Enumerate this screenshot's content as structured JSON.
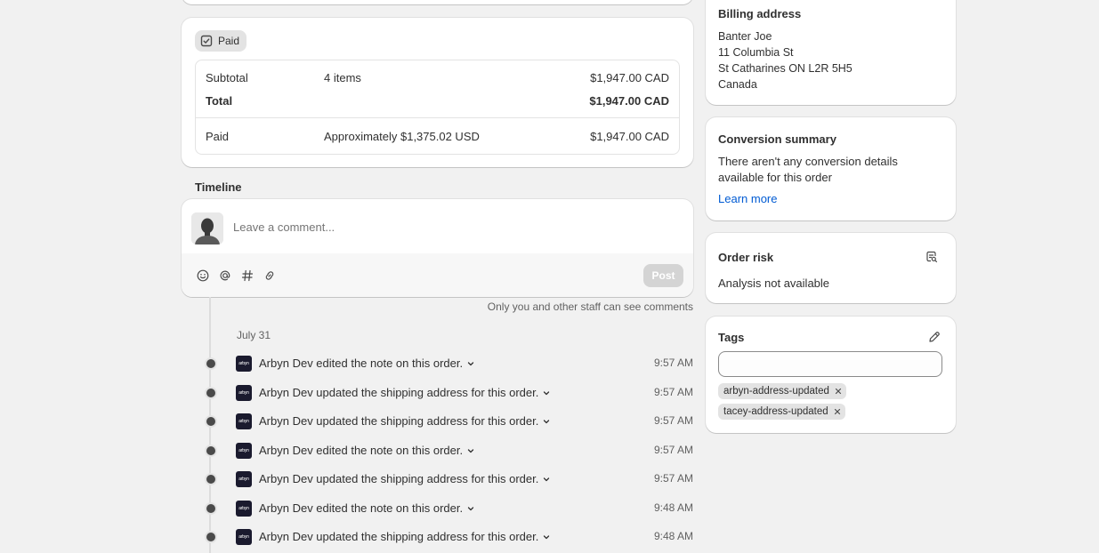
{
  "payment": {
    "badge": "Paid",
    "rows": [
      {
        "label": "Subtotal",
        "detail": "4 items",
        "amount": "$1,947.00 CAD"
      },
      {
        "label": "Total",
        "detail": "",
        "amount": "$1,947.00 CAD"
      },
      {
        "label": "Paid",
        "detail": "Approximately $1,375.02 USD",
        "amount": "$1,947.00 CAD"
      }
    ]
  },
  "timeline": {
    "title": "Timeline",
    "comment_placeholder": "Leave a comment...",
    "post_label": "Post",
    "staff_note": "Only you and other staff can see comments",
    "date": "July 31",
    "logo_text": "arbyn",
    "events": [
      {
        "text": "Arbyn Dev edited the note on this order.",
        "time": "9:57 AM"
      },
      {
        "text": "Arbyn Dev updated the shipping address for this order.",
        "time": "9:57 AM"
      },
      {
        "text": "Arbyn Dev updated the shipping address for this order.",
        "time": "9:57 AM"
      },
      {
        "text": "Arbyn Dev edited the note on this order.",
        "time": "9:57 AM"
      },
      {
        "text": "Arbyn Dev updated the shipping address for this order.",
        "time": "9:57 AM"
      },
      {
        "text": "Arbyn Dev edited the note on this order.",
        "time": "9:48 AM"
      },
      {
        "text": "Arbyn Dev updated the shipping address for this order.",
        "time": "9:48 AM"
      }
    ]
  },
  "billing": {
    "title": "Billing address",
    "lines": [
      "Banter Joe",
      "11 Columbia St",
      "St Catharines ON L2R 5H5",
      "Canada"
    ]
  },
  "conversion": {
    "title": "Conversion summary",
    "text": "There aren't any conversion details available for this order",
    "link": "Learn more"
  },
  "risk": {
    "title": "Order risk",
    "text": "Analysis not available"
  },
  "tags": {
    "title": "Tags",
    "items": [
      "arbyn-address-updated",
      "tacey-address-updated"
    ]
  },
  "colors": {
    "link": "#005bd3",
    "background": "#f1f1f1",
    "card": "#ffffff"
  }
}
